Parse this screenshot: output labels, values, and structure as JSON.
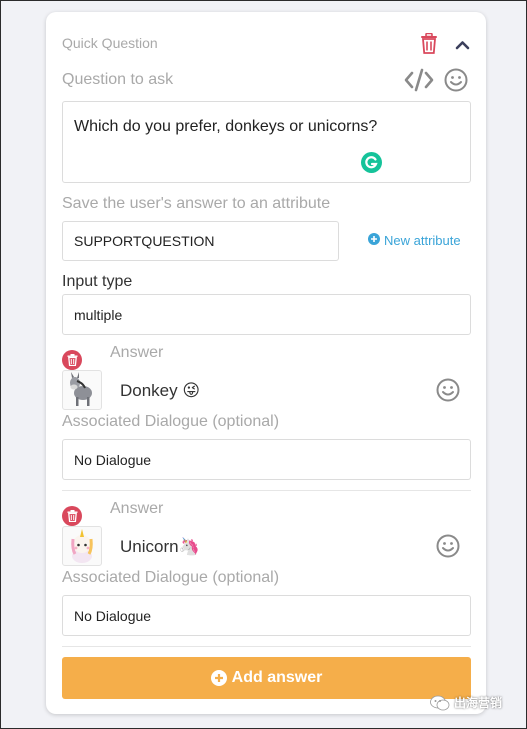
{
  "block": {
    "title": "Quick Question",
    "question_label": "Question to ask",
    "question_text": "Which do you prefer, donkeys or unicorns?",
    "save_label": "Save the user's answer to an attribute",
    "attribute_value": "SUPPORTQUESTION",
    "new_attribute_label": "New attribute",
    "input_type_label": "Input type",
    "input_type_value": "multiple"
  },
  "answers": [
    {
      "label": "Answer",
      "text": "Donkey 😜",
      "dialogue_label": "Associated Dialogue (optional)",
      "dialogue_value": "No Dialogue"
    },
    {
      "label": "Answer",
      "text": "Unicorn🦄",
      "dialogue_label": "Associated Dialogue (optional)",
      "dialogue_value": "No Dialogue"
    }
  ],
  "add_answer_label": "Add answer",
  "watermark_text": "出海营销",
  "colors": {
    "delete_red": "#d9485c",
    "accent_orange": "#f5ae4a",
    "link_blue": "#3aa4d8",
    "grammarly_green": "#15c39a"
  },
  "icons": [
    "trash-icon",
    "chevron-up-icon",
    "code-icon",
    "emoji-icon",
    "grammarly-icon",
    "plus-circle-icon",
    "donkey-thumbnail",
    "unicorn-thumbnail",
    "wechat-icon"
  ]
}
